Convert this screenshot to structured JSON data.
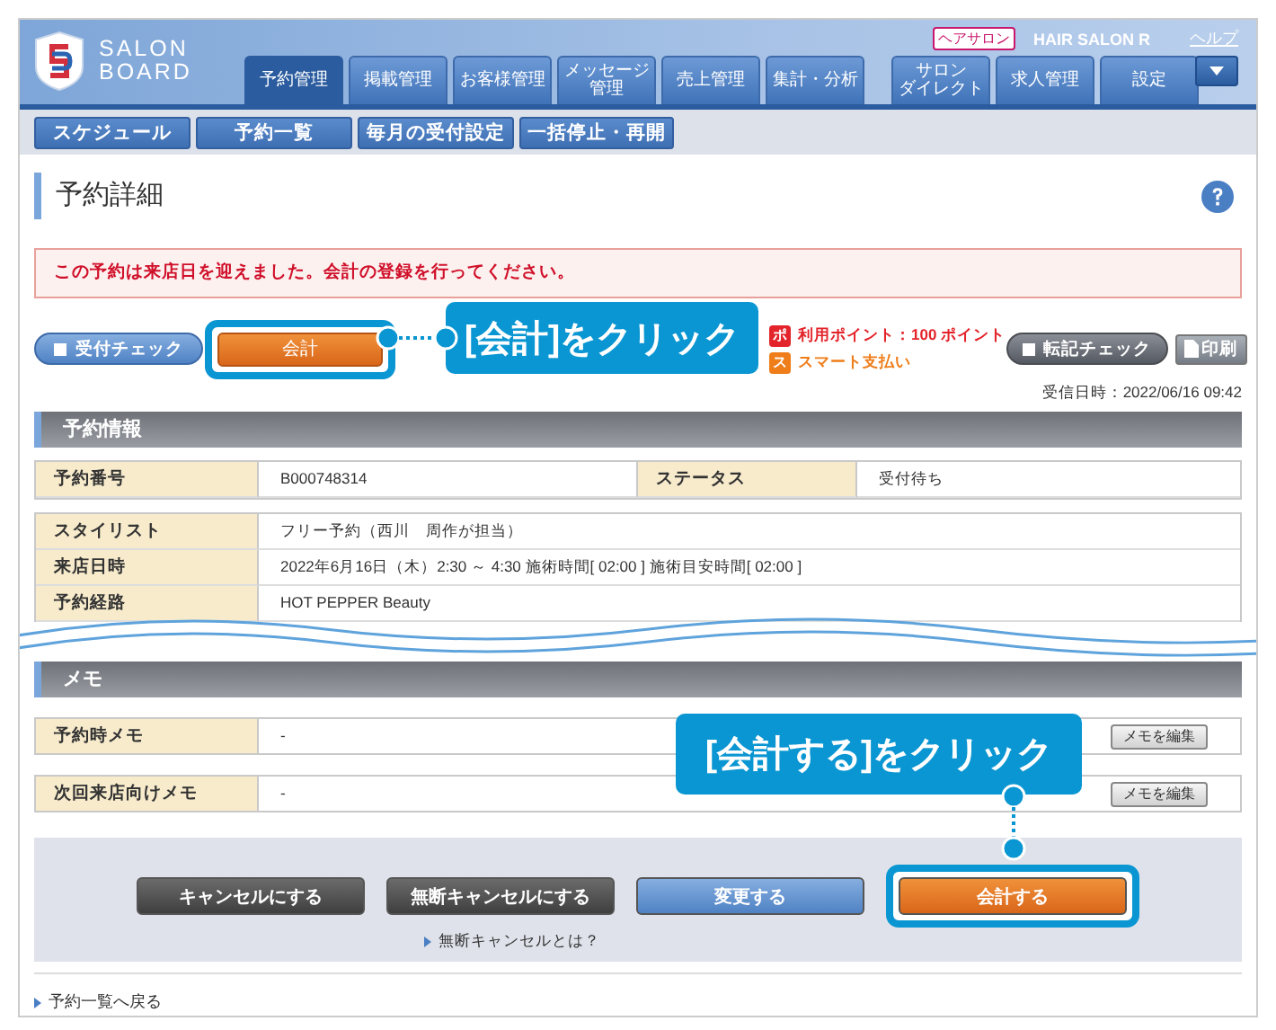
{
  "logo": {
    "line1": "SALON",
    "line2": "BOARD"
  },
  "account": {
    "badge": "ヘアサロン",
    "salon_name": "HAIR SALON R",
    "help_link": "ヘルプ"
  },
  "nav_tabs": [
    {
      "lines": [
        "予約管理"
      ],
      "selected": true
    },
    {
      "lines": [
        "掲載管理"
      ],
      "selected": false
    },
    {
      "lines": [
        "お客様管理"
      ],
      "selected": false
    },
    {
      "lines": [
        "メッセージ",
        "管理"
      ],
      "selected": false
    },
    {
      "lines": [
        "売上管理"
      ],
      "selected": false
    },
    {
      "lines": [
        "集計・分析"
      ],
      "selected": false
    },
    {
      "lines": [
        "サロン",
        "ダイレクト"
      ],
      "selected": false
    },
    {
      "lines": [
        "求人管理"
      ],
      "selected": false
    },
    {
      "lines": [
        "設定"
      ],
      "selected": false
    }
  ],
  "sub_nav": [
    "スケジュール",
    "予約一覧",
    "毎月の受付設定",
    "一括停止・再開"
  ],
  "page_title": "予約詳細",
  "alert": "この予約は来店日を迎えました。会計の登録を行ってください。",
  "reception_check": "受付チェック",
  "checkout_button": {
    "label": "会計",
    "highlighted": true
  },
  "points": [
    {
      "badge": "ポ",
      "text": "利用ポイント：100 ポイント",
      "color": "#e3242b"
    },
    {
      "badge": "ス",
      "text": "スマート支払い",
      "color": "#ee7d1a"
    }
  ],
  "transfer_check": "転記チェック",
  "print": "印刷",
  "received_at": "受信日時：2022/06/16 09:42",
  "reservation_info": {
    "title": "予約情報",
    "summary": [
      {
        "label": "予約番号",
        "value": "B000748314"
      },
      {
        "label": "ステータス",
        "value": "受付待ち"
      }
    ],
    "details": [
      {
        "label": "スタイリスト",
        "value": "フリー予約（西川　周作が担当）"
      },
      {
        "label": "来店日時",
        "value": "2022年6月16日（木）2:30 ～ 4:30 施術時間[ 02:00 ]  施術目安時間[ 02:00 ]"
      },
      {
        "label": "予約経路",
        "value": "HOT PEPPER Beauty"
      }
    ]
  },
  "memo": {
    "title": "メモ",
    "rows": [
      {
        "label": "予約時メモ",
        "value": "-",
        "button": "メモを編集"
      },
      {
        "label": "次回来店向けメモ",
        "value": "-",
        "button": "メモを編集"
      }
    ]
  },
  "footer_buttons": [
    {
      "label": "キャンセルにする",
      "kind": "dark",
      "highlighted": false
    },
    {
      "label": "無断キャンセルにする",
      "kind": "dark",
      "highlighted": false
    },
    {
      "label": "変更する",
      "kind": "blue",
      "highlighted": false
    },
    {
      "label": "会計する",
      "kind": "orange",
      "highlighted": true
    }
  ],
  "no_show_link": "無断キャンセルとは？",
  "back_link": "予約一覧へ戻る",
  "callouts": [
    {
      "text": "[会計]をクリック"
    },
    {
      "text": "[会計する]をクリック"
    }
  ]
}
